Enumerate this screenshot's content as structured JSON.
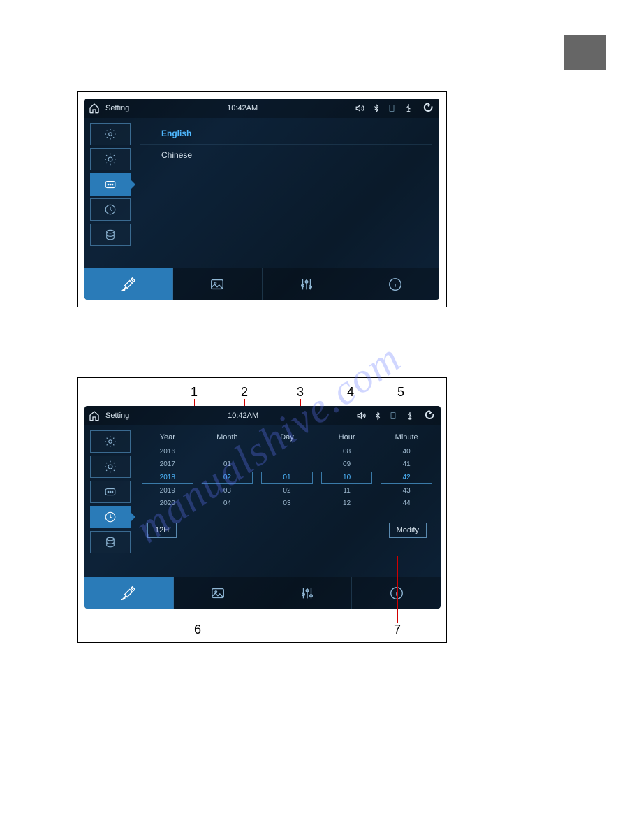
{
  "header": {
    "title": "Setting",
    "time": "10:42AM"
  },
  "languages": {
    "english": "English",
    "chinese": "Chinese"
  },
  "datetime": {
    "year": {
      "label": "Year",
      "values": [
        "2016",
        "2017",
        "2018",
        "2019",
        "2020"
      ],
      "selected": "2018"
    },
    "month": {
      "label": "Month",
      "values": [
        "01",
        "02",
        "03",
        "04"
      ],
      "selected": "02"
    },
    "day": {
      "label": "Day",
      "values": [
        "01",
        "02",
        "03"
      ],
      "selected": "01"
    },
    "hour": {
      "label": "Hour",
      "values": [
        "08",
        "09",
        "10",
        "11",
        "12"
      ],
      "selected": "10"
    },
    "minute": {
      "label": "Minute",
      "values": [
        "40",
        "41",
        "42",
        "43",
        "44"
      ],
      "selected": "42"
    }
  },
  "buttons": {
    "format": "12H",
    "modify": "Modify"
  },
  "callouts": {
    "c1": "1",
    "c2": "2",
    "c3": "3",
    "c4": "4",
    "c5": "5",
    "c6": "6",
    "c7": "7"
  }
}
